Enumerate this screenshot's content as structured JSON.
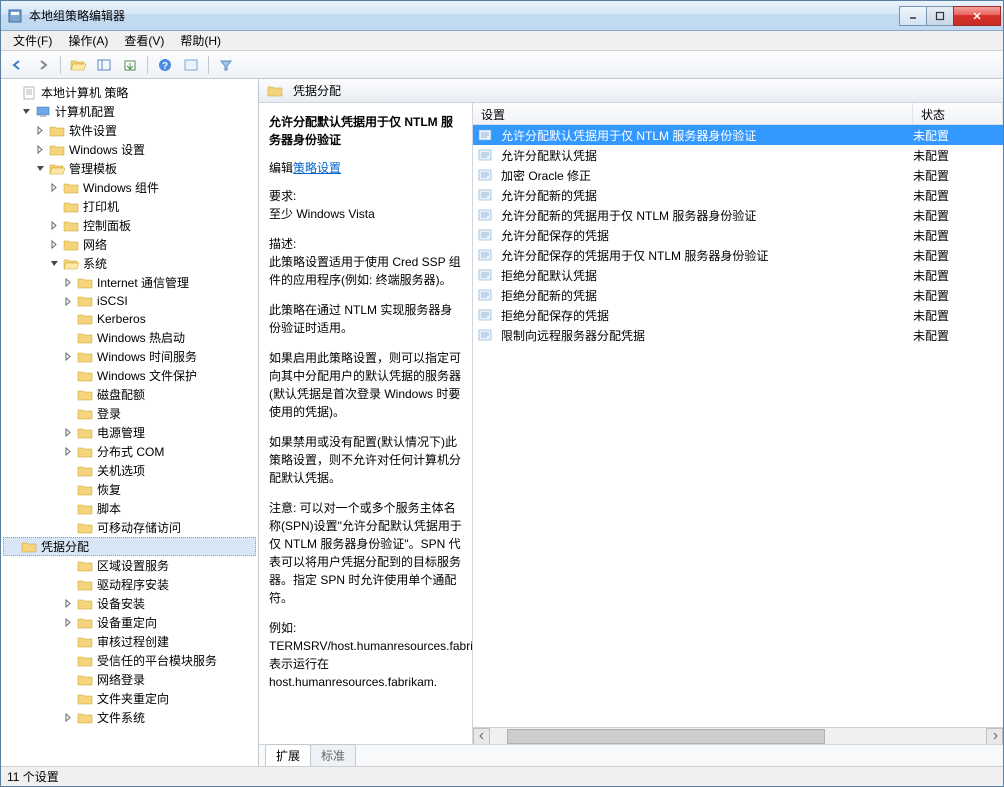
{
  "window": {
    "title": "本地组策略编辑器"
  },
  "menu": {
    "file": "文件(F)",
    "action": "操作(A)",
    "view": "查看(V)",
    "help": "帮助(H)"
  },
  "tree": {
    "root": "本地计算机 策略",
    "computer_config": "计算机配置",
    "software_settings": "软件设置",
    "windows_settings": "Windows 设置",
    "admin_templates": "管理模板",
    "windows_components": "Windows 组件",
    "printers": "打印机",
    "control_panel": "控制面板",
    "network": "网络",
    "system": "系统",
    "internet_comm": "Internet 通信管理",
    "iscsi": "iSCSI",
    "kerberos": "Kerberos",
    "windows_hot_start": "Windows 热启动",
    "windows_time_service": "Windows 时间服务",
    "windows_file_protection": "Windows 文件保护",
    "disk_quota": "磁盘配额",
    "logon": "登录",
    "power_mgmt": "电源管理",
    "distributed_com": "分布式 COM",
    "shutdown_options": "关机选项",
    "recovery": "恢复",
    "scripts": "脚本",
    "removable_storage": "可移动存储访问",
    "credentials_delegation": "凭据分配",
    "locale_services": "区域设置服务",
    "driver_install": "驱动程序安装",
    "device_install": "设备安装",
    "device_redirect": "设备重定向",
    "audit_process": "审核过程创建",
    "trusted_platform": "受信任的平台模块服务",
    "network_logon": "网络登录",
    "folder_redirect": "文件夹重定向",
    "file_system": "文件系统"
  },
  "header": {
    "title": "凭据分配"
  },
  "desc": {
    "title": "允许分配默认凭据用于仅 NTLM 服务器身份验证",
    "edit_label": "编辑",
    "edit_link": "策略设置",
    "req_label": "要求:",
    "req_value": "至少 Windows Vista",
    "desc_label": "描述:",
    "p1": "此策略设置适用于使用 Cred SSP 组件的应用程序(例如: 终端服务器)。",
    "p2": "此策略在通过 NTLM 实现服务器身份验证时适用。",
    "p3": "如果启用此策略设置，则可以指定可向其中分配用户的默认凭据的服务器(默认凭据是首次登录 Windows 时要使用的凭据)。",
    "p4": "如果禁用或没有配置(默认情况下)此策略设置，则不允许对任何计算机分配默认凭据。",
    "p5": "注意: 可以对一个或多个服务主体名称(SPN)设置\"允许分配默认凭据用于仅 NTLM 服务器身份验证\"。SPN 代表可以将用户凭据分配到的目标服务器。指定 SPN 时允许使用单个通配符。",
    "p6_label": "例如:",
    "p6": "TERMSRV/host.humanresources.fabrikam.com 表示运行在 host.humanresources.fabrikam."
  },
  "list": {
    "col_setting": "设置",
    "col_status": "状态",
    "rows": [
      {
        "name": "允许分配默认凭据用于仅 NTLM 服务器身份验证",
        "status": "未配置"
      },
      {
        "name": "允许分配默认凭据",
        "status": "未配置"
      },
      {
        "name": "加密 Oracle 修正",
        "status": "未配置"
      },
      {
        "name": "允许分配新的凭据",
        "status": "未配置"
      },
      {
        "name": "允许分配新的凭据用于仅 NTLM 服务器身份验证",
        "status": "未配置"
      },
      {
        "name": "允许分配保存的凭据",
        "status": "未配置"
      },
      {
        "name": "允许分配保存的凭据用于仅 NTLM 服务器身份验证",
        "status": "未配置"
      },
      {
        "name": "拒绝分配默认凭据",
        "status": "未配置"
      },
      {
        "name": "拒绝分配新的凭据",
        "status": "未配置"
      },
      {
        "name": "拒绝分配保存的凭据",
        "status": "未配置"
      },
      {
        "name": "限制向远程服务器分配凭据",
        "status": "未配置"
      }
    ]
  },
  "tabs": {
    "extended": "扩展",
    "standard": "标准"
  },
  "statusbar": {
    "text": "11 个设置"
  }
}
